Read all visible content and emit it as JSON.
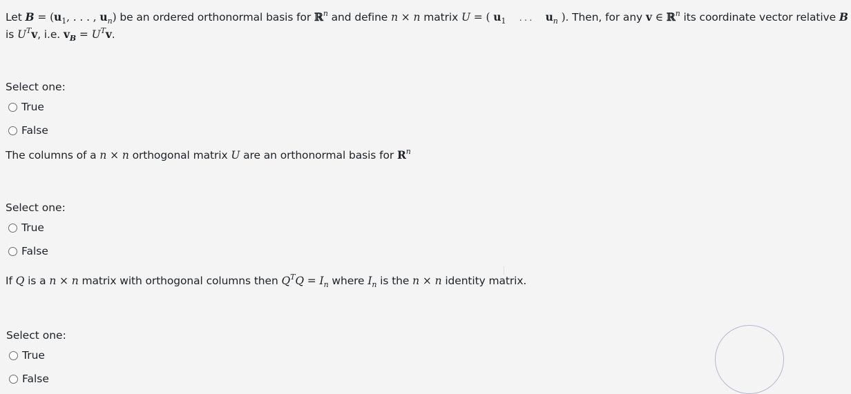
{
  "questions": [
    {
      "text": {
        "p1": "Let ",
        "p2": " be an ordered orthonormal basis for ",
        "p3": " and define ",
        "p4": " matrix ",
        "p5": ". Then, for any ",
        "p6": " its coordinate vector relative ",
        "line2_a": "is ",
        "line2_b": ", i.e. "
      },
      "select_label": "Select one:",
      "options": [
        "True",
        "False"
      ]
    },
    {
      "text": {
        "p1": "The columns of a ",
        "p2": " orthogonal matrix ",
        "p3": " are an orthonormal basis for "
      },
      "select_label": "Select one:",
      "options": [
        "True",
        "False"
      ]
    },
    {
      "text": {
        "p1": "If ",
        "p2": " is a ",
        "p3": " matrix with orthogonal columns then ",
        "p4": " where ",
        "p5": " is the ",
        "p6": " identity matrix."
      },
      "select_label": "Select one:",
      "options": [
        "True",
        "False"
      ]
    }
  ]
}
